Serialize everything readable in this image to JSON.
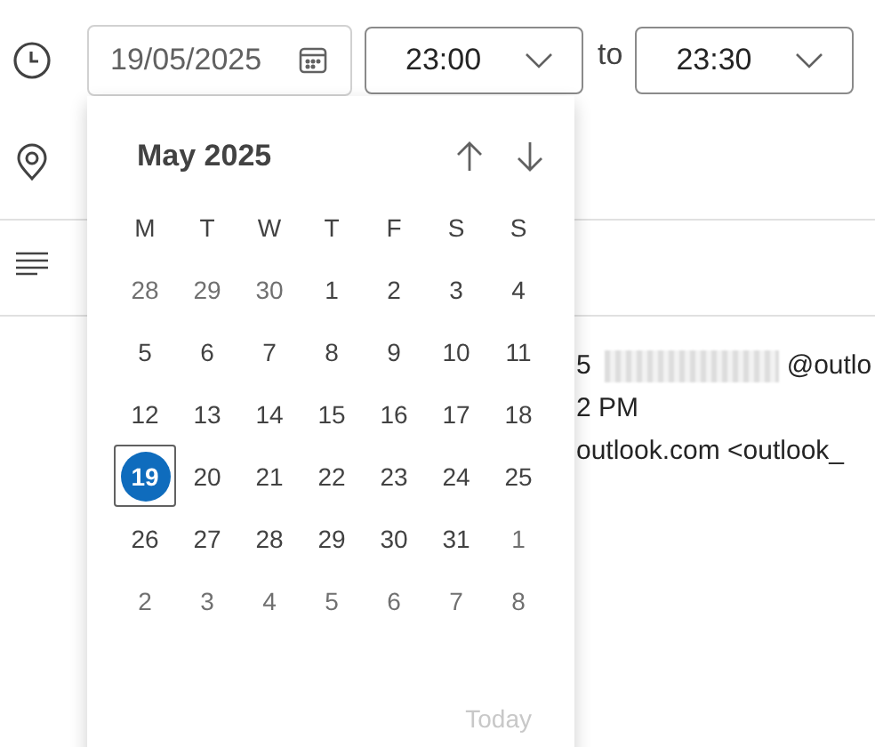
{
  "date_field": {
    "value": "19/05/2025"
  },
  "start_time": {
    "value": "23:00"
  },
  "separator": "to",
  "end_time": {
    "value": "23:30"
  },
  "message": {
    "lines": [
      {
        "kind": "redacted",
        "before": "5",
        "after": "@outlo"
      },
      {
        "kind": "text",
        "text": "2 PM"
      },
      {
        "kind": "text",
        "text": "outlook.com <outlook_"
      }
    ]
  },
  "calendar": {
    "month_label": "May 2025",
    "weekdays": [
      "M",
      "T",
      "W",
      "T",
      "F",
      "S",
      "S"
    ],
    "weeks": [
      [
        {
          "day": "28",
          "outside": true,
          "selected": false
        },
        {
          "day": "29",
          "outside": true,
          "selected": false
        },
        {
          "day": "30",
          "outside": true,
          "selected": false
        },
        {
          "day": "1",
          "outside": false,
          "selected": false
        },
        {
          "day": "2",
          "outside": false,
          "selected": false
        },
        {
          "day": "3",
          "outside": false,
          "selected": false
        },
        {
          "day": "4",
          "outside": false,
          "selected": false
        }
      ],
      [
        {
          "day": "5",
          "outside": false,
          "selected": false
        },
        {
          "day": "6",
          "outside": false,
          "selected": false
        },
        {
          "day": "7",
          "outside": false,
          "selected": false
        },
        {
          "day": "8",
          "outside": false,
          "selected": false
        },
        {
          "day": "9",
          "outside": false,
          "selected": false
        },
        {
          "day": "10",
          "outside": false,
          "selected": false
        },
        {
          "day": "11",
          "outside": false,
          "selected": false
        }
      ],
      [
        {
          "day": "12",
          "outside": false,
          "selected": false
        },
        {
          "day": "13",
          "outside": false,
          "selected": false
        },
        {
          "day": "14",
          "outside": false,
          "selected": false
        },
        {
          "day": "15",
          "outside": false,
          "selected": false
        },
        {
          "day": "16",
          "outside": false,
          "selected": false
        },
        {
          "day": "17",
          "outside": false,
          "selected": false
        },
        {
          "day": "18",
          "outside": false,
          "selected": false
        }
      ],
      [
        {
          "day": "19",
          "outside": false,
          "selected": true
        },
        {
          "day": "20",
          "outside": false,
          "selected": false
        },
        {
          "day": "21",
          "outside": false,
          "selected": false
        },
        {
          "day": "22",
          "outside": false,
          "selected": false
        },
        {
          "day": "23",
          "outside": false,
          "selected": false
        },
        {
          "day": "24",
          "outside": false,
          "selected": false
        },
        {
          "day": "25",
          "outside": false,
          "selected": false
        }
      ],
      [
        {
          "day": "26",
          "outside": false,
          "selected": false
        },
        {
          "day": "27",
          "outside": false,
          "selected": false
        },
        {
          "day": "28",
          "outside": false,
          "selected": false
        },
        {
          "day": "29",
          "outside": false,
          "selected": false
        },
        {
          "day": "30",
          "outside": false,
          "selected": false
        },
        {
          "day": "31",
          "outside": false,
          "selected": false
        },
        {
          "day": "1",
          "outside": true,
          "selected": false
        }
      ],
      [
        {
          "day": "2",
          "outside": true,
          "selected": false
        },
        {
          "day": "3",
          "outside": true,
          "selected": false
        },
        {
          "day": "4",
          "outside": true,
          "selected": false
        },
        {
          "day": "5",
          "outside": true,
          "selected": false
        },
        {
          "day": "6",
          "outside": true,
          "selected": false
        },
        {
          "day": "7",
          "outside": true,
          "selected": false
        },
        {
          "day": "8",
          "outside": true,
          "selected": false
        }
      ]
    ],
    "today_label": "Today"
  }
}
